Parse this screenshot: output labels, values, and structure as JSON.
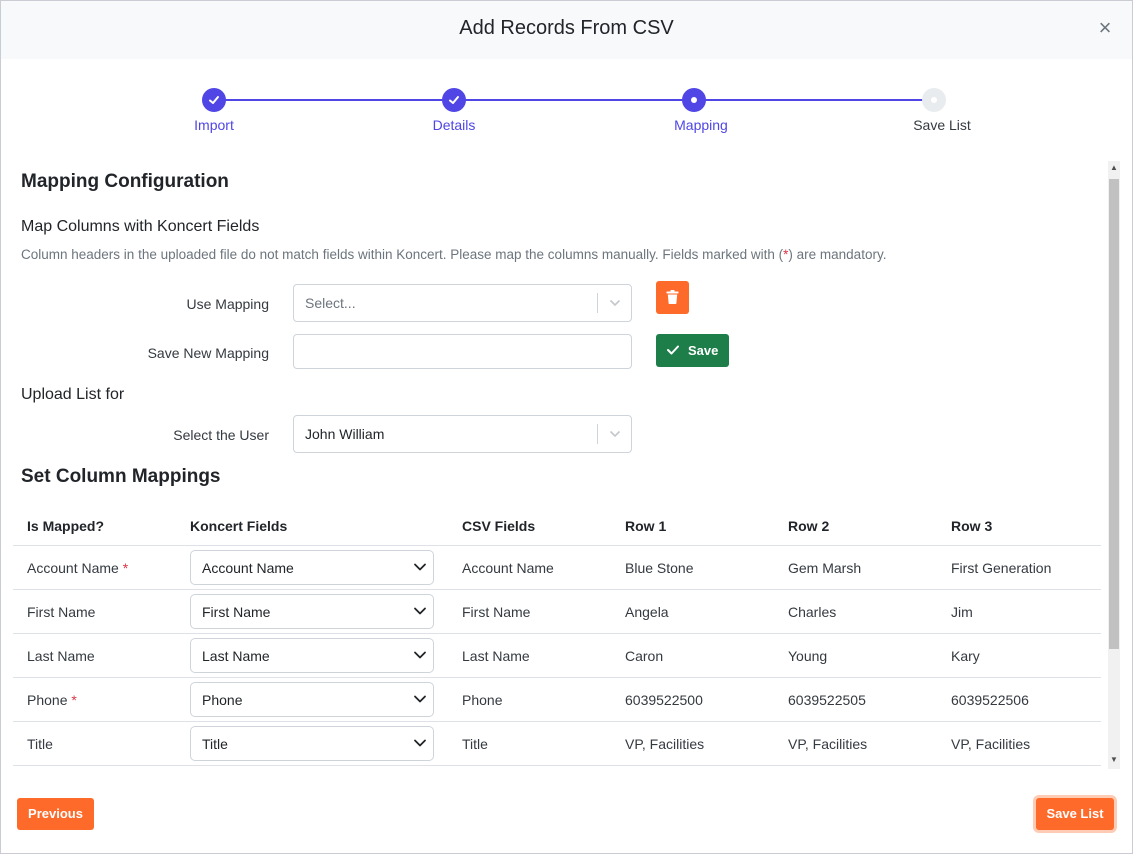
{
  "modal": {
    "title": "Add Records From CSV",
    "close_symbol": "×"
  },
  "colors": {
    "accent": "#4f46e5",
    "orange": "#fd6a2a",
    "green": "#1e7e4a",
    "required": "#dc3545"
  },
  "stepper": {
    "steps": [
      {
        "label": "Import",
        "state": "done"
      },
      {
        "label": "Details",
        "state": "done"
      },
      {
        "label": "Mapping",
        "state": "active"
      },
      {
        "label": "Save List",
        "state": "pending"
      }
    ]
  },
  "mapping_config": {
    "heading": "Mapping Configuration",
    "sub_heading": "Map Columns with Koncert Fields",
    "description_pre": "Column headers in the uploaded file do not match fields within Koncert. Please map the columns manually. Fields marked with (",
    "description_req": "*",
    "description_post": ") are mandatory.",
    "use_mapping_label": "Use Mapping",
    "use_mapping_placeholder": "Select...",
    "save_new_mapping_label": "Save New Mapping",
    "save_new_mapping_value": "",
    "save_button": "Save"
  },
  "upload": {
    "heading": "Upload List for",
    "select_user_label": "Select the User",
    "selected_user": "John William"
  },
  "column_mappings": {
    "heading": "Set Column Mappings",
    "headers": [
      "Is Mapped?",
      "Koncert Fields",
      "CSV Fields",
      "Row 1",
      "Row 2",
      "Row 3"
    ],
    "rows": [
      {
        "is_mapped": "Account Name",
        "required": "*",
        "koncert_field": "Account Name",
        "csv_field": "Account Name",
        "row1": "Blue Stone",
        "row2": "Gem Marsh",
        "row3": "First Generation"
      },
      {
        "is_mapped": "First Name",
        "required": "",
        "koncert_field": "First Name",
        "csv_field": "First Name",
        "row1": "Angela",
        "row2": "Charles",
        "row3": "Jim"
      },
      {
        "is_mapped": "Last Name",
        "required": "",
        "koncert_field": "Last Name",
        "csv_field": "Last Name",
        "row1": "Caron",
        "row2": "Young",
        "row3": "Kary"
      },
      {
        "is_mapped": "Phone",
        "required": "*",
        "koncert_field": "Phone",
        "csv_field": "Phone",
        "row1": "6039522500",
        "row2": "6039522505",
        "row3": "6039522506"
      },
      {
        "is_mapped": "Title",
        "required": "",
        "koncert_field": "Title",
        "csv_field": "Title",
        "row1": "VP, Facilities",
        "row2": "VP, Facilities",
        "row3": "VP, Facilities"
      }
    ]
  },
  "footer": {
    "previous_button": "Previous",
    "save_list_button": "Save List"
  }
}
